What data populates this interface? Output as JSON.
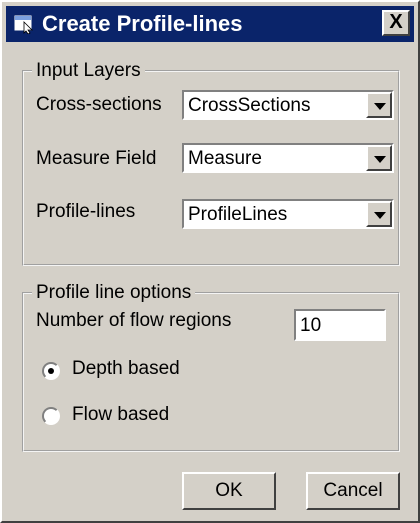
{
  "window": {
    "title": "Create Profile-lines",
    "close_glyph": "X",
    "title_icon": "app-window-icon"
  },
  "input_layers": {
    "legend": "Input Layers",
    "cross_sections": {
      "label": "Cross-sections",
      "value": "CrossSections"
    },
    "measure_field": {
      "label": "Measure Field",
      "value": "Measure"
    },
    "profile_lines": {
      "label": "Profile-lines",
      "value": "ProfileLines"
    }
  },
  "profile_options": {
    "legend": "Profile line options",
    "flow_regions": {
      "label": "Number of flow regions",
      "value": "10"
    },
    "depth_based": {
      "label": "Depth based",
      "selected": true
    },
    "flow_based": {
      "label": "Flow based",
      "selected": false
    }
  },
  "buttons": {
    "ok": "OK",
    "cancel": "Cancel"
  },
  "colors": {
    "titlebar": "#0a246a",
    "face": "#d4d0c8"
  }
}
